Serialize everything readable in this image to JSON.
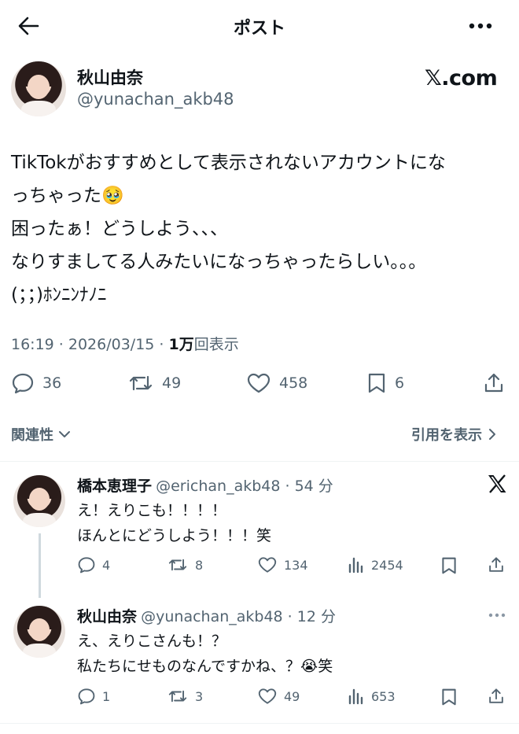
{
  "header": {
    "title": "ポスト"
  },
  "post": {
    "display_name": "秋山由奈",
    "handle": "@yunachan_akb48",
    "brand": "𝕏.com",
    "text": "TikTokがおすすめとして表示されないアカウントにな\nっちゃった🥹\n困ったぁ！どうしよう、、、\nなりすましてる人みたいになっちゃったらしい。。。\n(；；)ﾎﾝﾆﾝﾅﾉﾆ",
    "time": "16:19 · 2026/03/15 · ",
    "views_count": "1万",
    "views_label": "回表示",
    "stats": {
      "replies": "36",
      "reposts": "49",
      "likes": "458",
      "bookmarks": "6"
    }
  },
  "links": {
    "related": "関連性",
    "quotes": "引用を表示"
  },
  "replies": [
    {
      "display_name": "橋本恵理子",
      "meta": "@erichan_akb48 · 54 分",
      "text": "え！えりこも！！！！\nほんとにどうしよう！！！笑",
      "stats": {
        "replies": "4",
        "reposts": "8",
        "likes": "134",
        "views": "2454"
      }
    },
    {
      "display_name": "秋山由奈",
      "meta": "@yunachan_akb48 · 12 分",
      "text": "え、えりこさんも！？\n私たちにせものなんですかね、？😭笑",
      "stats": {
        "replies": "1",
        "reposts": "3",
        "likes": "49",
        "views": "653"
      }
    }
  ],
  "icons": [
    "back-arrow-icon",
    "reply-icon",
    "repost-icon",
    "like-icon",
    "bookmark-icon",
    "share-icon",
    "chevron-down-icon",
    "chevron-right-icon",
    "x-logo-icon",
    "more-icon",
    "views-icon"
  ]
}
